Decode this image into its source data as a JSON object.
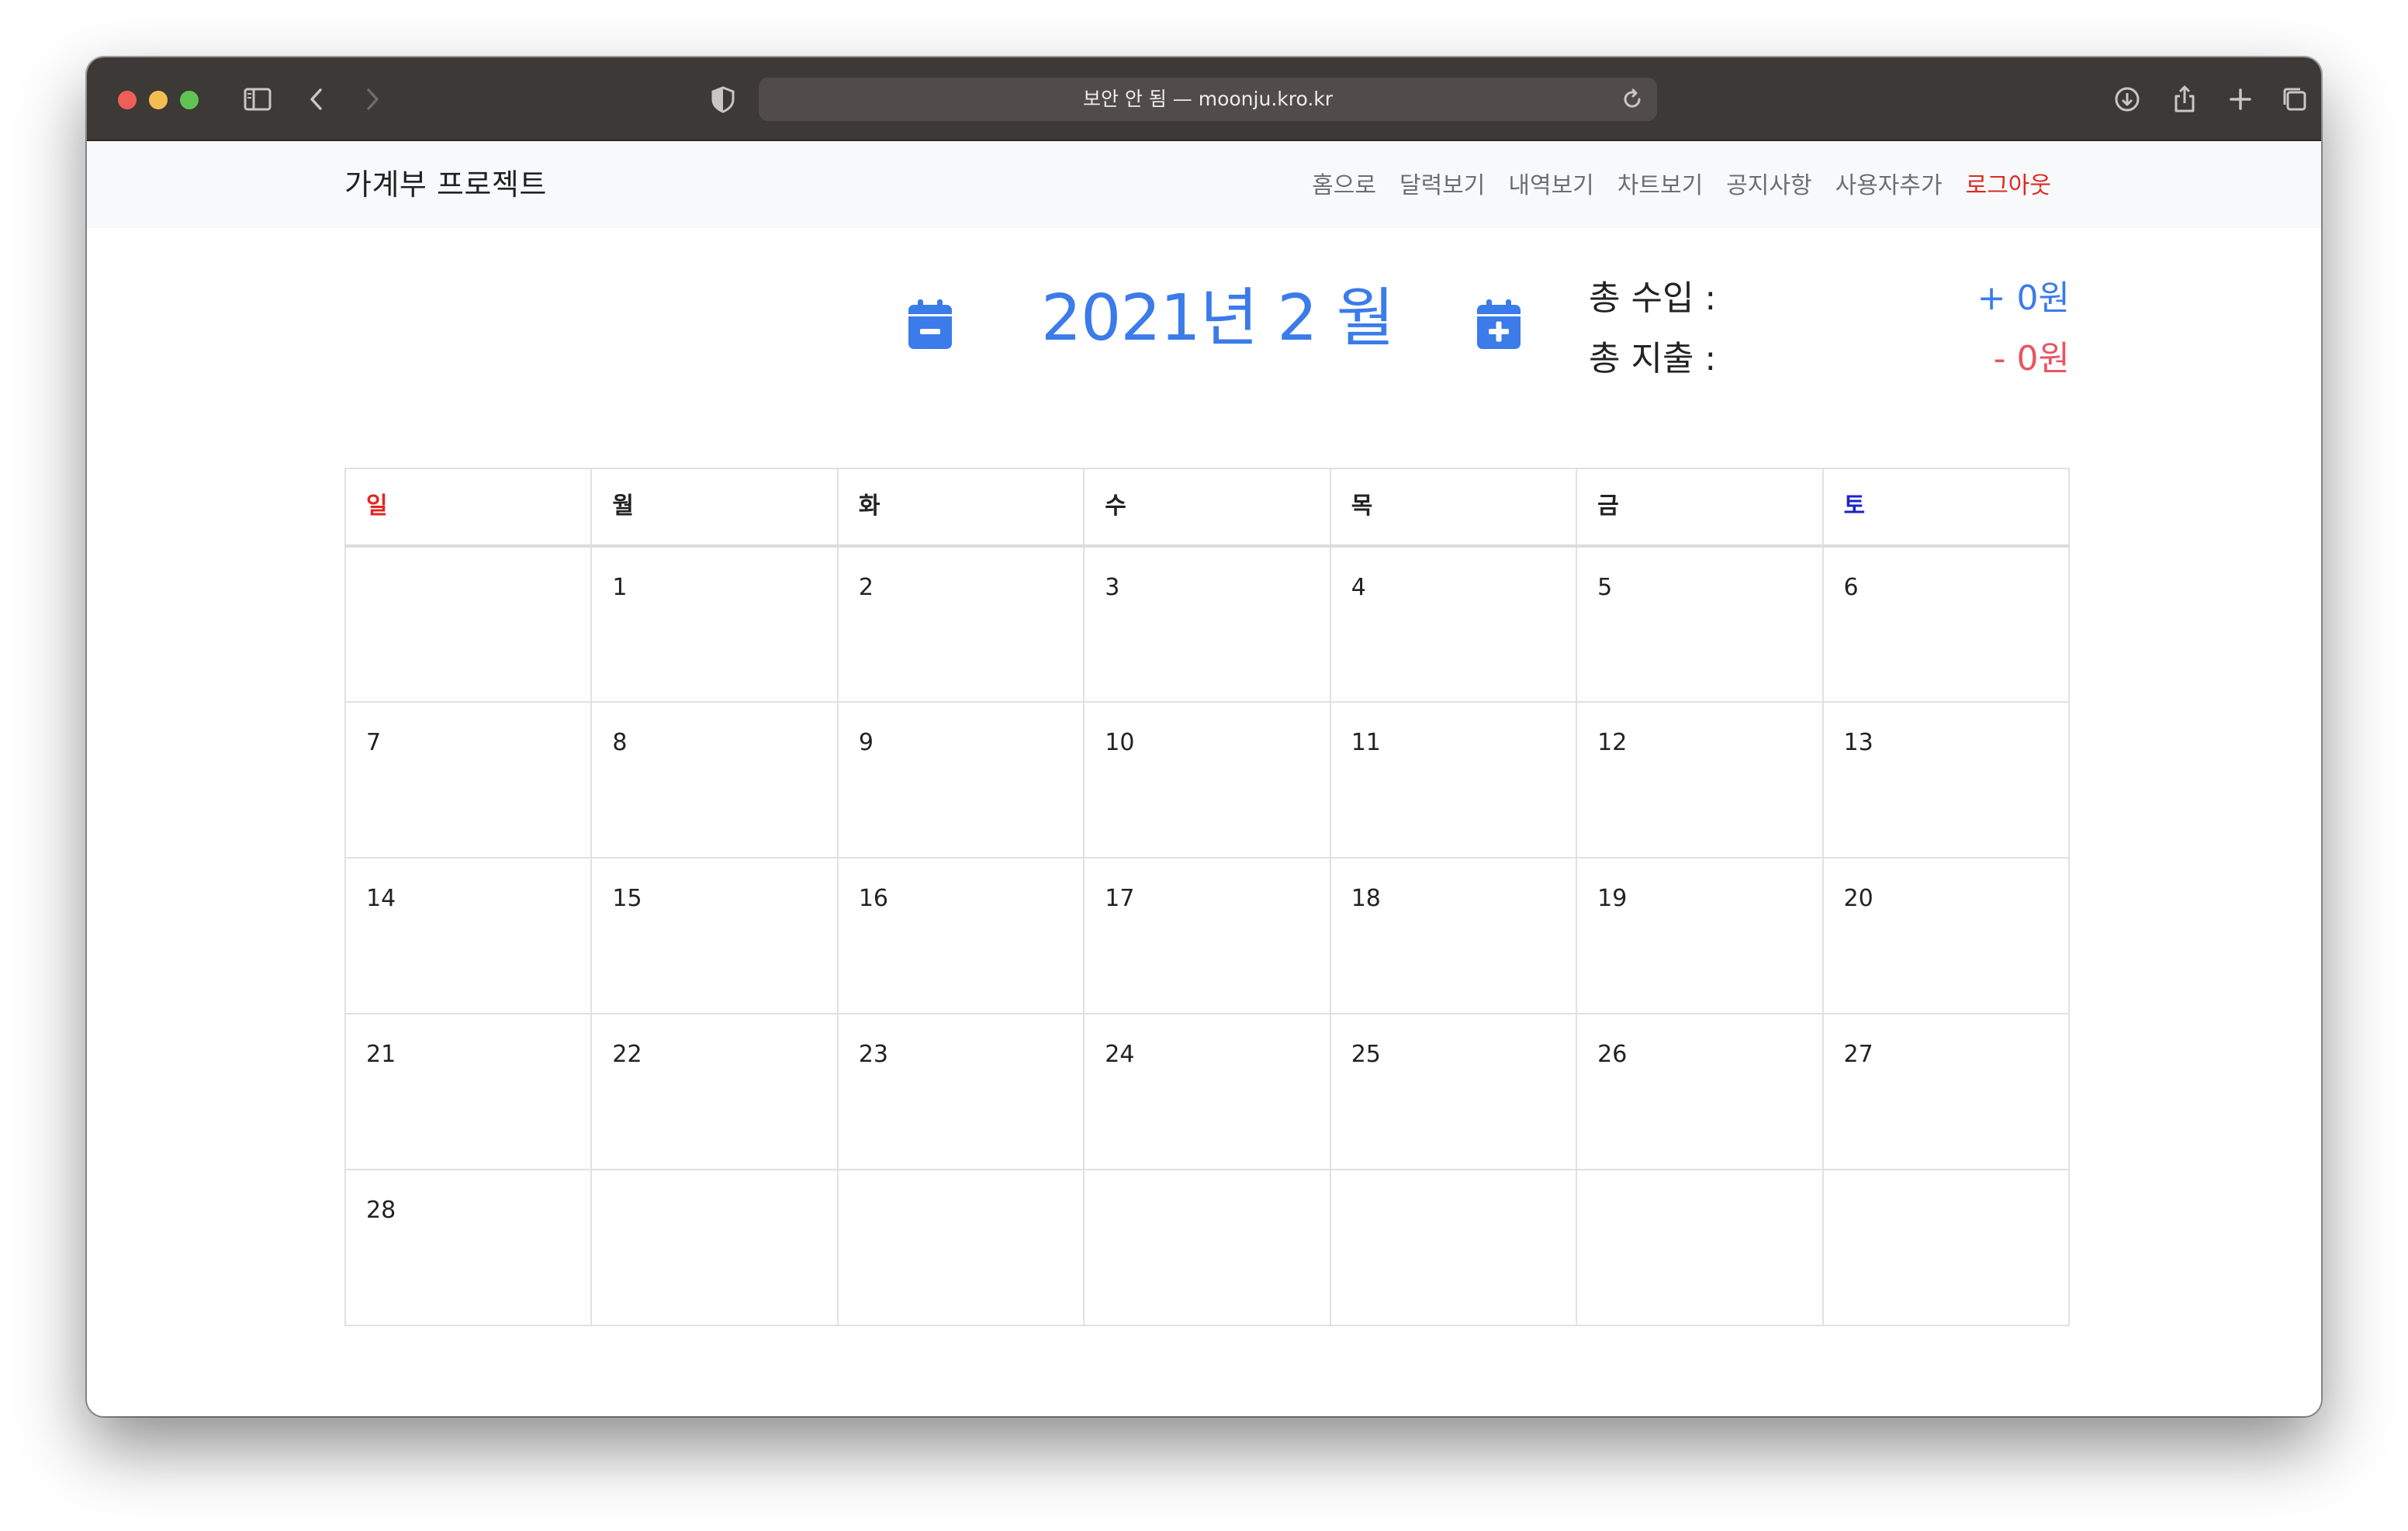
{
  "browser": {
    "url_text": "보안 안 됨 — moonju.kro.kr"
  },
  "navbar": {
    "brand": "가계부 프로젝트",
    "links": [
      "홈으로",
      "달력보기",
      "내역보기",
      "차트보기",
      "공지사항",
      "사용자추가"
    ],
    "logout": "로그아웃"
  },
  "calendar": {
    "title": "2021년 2 월",
    "weekdays": [
      "일",
      "월",
      "화",
      "수",
      "목",
      "금",
      "토"
    ],
    "weeks": [
      [
        "",
        "1",
        "2",
        "3",
        "4",
        "5",
        "6"
      ],
      [
        "7",
        "8",
        "9",
        "10",
        "11",
        "12",
        "13"
      ],
      [
        "14",
        "15",
        "16",
        "17",
        "18",
        "19",
        "20"
      ],
      [
        "21",
        "22",
        "23",
        "24",
        "25",
        "26",
        "27"
      ],
      [
        "28",
        "",
        "",
        "",
        "",
        "",
        ""
      ]
    ]
  },
  "totals": {
    "income_label": "총 수입 :",
    "income_value": "+ 0원",
    "expense_label": "총 지출 :",
    "expense_value": "- 0원"
  },
  "colors": {
    "accent_blue": "#3b7bea",
    "expense_red": "#e85462",
    "sunday_red": "#e2261f",
    "saturday_blue": "#1c24c7",
    "logout_red": "#dc2a21"
  },
  "icons": [
    "sidebar-icon",
    "back-icon",
    "forward-icon",
    "shield-icon",
    "reload-icon",
    "download-icon",
    "share-icon",
    "new-tab-icon",
    "tabs-overview-icon",
    "calendar-minus-icon",
    "calendar-plus-icon"
  ]
}
